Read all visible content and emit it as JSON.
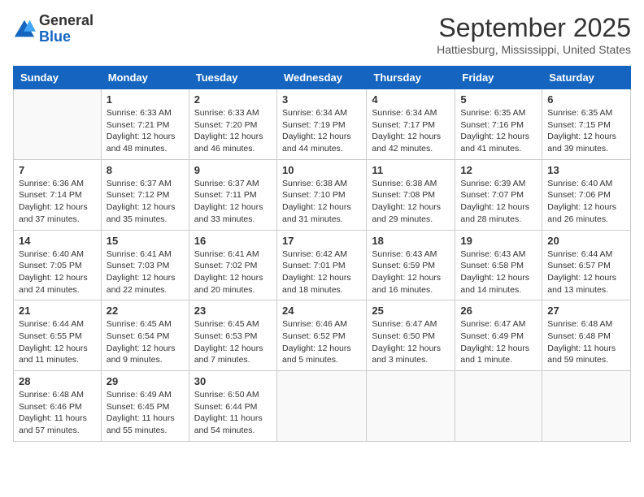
{
  "header": {
    "logo_general": "General",
    "logo_blue": "Blue",
    "month": "September 2025",
    "location": "Hattiesburg, Mississippi, United States"
  },
  "days_of_week": [
    "Sunday",
    "Monday",
    "Tuesday",
    "Wednesday",
    "Thursday",
    "Friday",
    "Saturday"
  ],
  "weeks": [
    [
      {
        "day": "",
        "empty": true
      },
      {
        "day": "1",
        "sunrise": "6:33 AM",
        "sunset": "7:21 PM",
        "daylight": "12 hours and 48 minutes."
      },
      {
        "day": "2",
        "sunrise": "6:33 AM",
        "sunset": "7:20 PM",
        "daylight": "12 hours and 46 minutes."
      },
      {
        "day": "3",
        "sunrise": "6:34 AM",
        "sunset": "7:19 PM",
        "daylight": "12 hours and 44 minutes."
      },
      {
        "day": "4",
        "sunrise": "6:34 AM",
        "sunset": "7:17 PM",
        "daylight": "12 hours and 42 minutes."
      },
      {
        "day": "5",
        "sunrise": "6:35 AM",
        "sunset": "7:16 PM",
        "daylight": "12 hours and 41 minutes."
      },
      {
        "day": "6",
        "sunrise": "6:35 AM",
        "sunset": "7:15 PM",
        "daylight": "12 hours and 39 minutes."
      }
    ],
    [
      {
        "day": "7",
        "sunrise": "6:36 AM",
        "sunset": "7:14 PM",
        "daylight": "12 hours and 37 minutes."
      },
      {
        "day": "8",
        "sunrise": "6:37 AM",
        "sunset": "7:12 PM",
        "daylight": "12 hours and 35 minutes."
      },
      {
        "day": "9",
        "sunrise": "6:37 AM",
        "sunset": "7:11 PM",
        "daylight": "12 hours and 33 minutes."
      },
      {
        "day": "10",
        "sunrise": "6:38 AM",
        "sunset": "7:10 PM",
        "daylight": "12 hours and 31 minutes."
      },
      {
        "day": "11",
        "sunrise": "6:38 AM",
        "sunset": "7:08 PM",
        "daylight": "12 hours and 29 minutes."
      },
      {
        "day": "12",
        "sunrise": "6:39 AM",
        "sunset": "7:07 PM",
        "daylight": "12 hours and 28 minutes."
      },
      {
        "day": "13",
        "sunrise": "6:40 AM",
        "sunset": "7:06 PM",
        "daylight": "12 hours and 26 minutes."
      }
    ],
    [
      {
        "day": "14",
        "sunrise": "6:40 AM",
        "sunset": "7:05 PM",
        "daylight": "12 hours and 24 minutes."
      },
      {
        "day": "15",
        "sunrise": "6:41 AM",
        "sunset": "7:03 PM",
        "daylight": "12 hours and 22 minutes."
      },
      {
        "day": "16",
        "sunrise": "6:41 AM",
        "sunset": "7:02 PM",
        "daylight": "12 hours and 20 minutes."
      },
      {
        "day": "17",
        "sunrise": "6:42 AM",
        "sunset": "7:01 PM",
        "daylight": "12 hours and 18 minutes."
      },
      {
        "day": "18",
        "sunrise": "6:43 AM",
        "sunset": "6:59 PM",
        "daylight": "12 hours and 16 minutes."
      },
      {
        "day": "19",
        "sunrise": "6:43 AM",
        "sunset": "6:58 PM",
        "daylight": "12 hours and 14 minutes."
      },
      {
        "day": "20",
        "sunrise": "6:44 AM",
        "sunset": "6:57 PM",
        "daylight": "12 hours and 13 minutes."
      }
    ],
    [
      {
        "day": "21",
        "sunrise": "6:44 AM",
        "sunset": "6:55 PM",
        "daylight": "12 hours and 11 minutes."
      },
      {
        "day": "22",
        "sunrise": "6:45 AM",
        "sunset": "6:54 PM",
        "daylight": "12 hours and 9 minutes."
      },
      {
        "day": "23",
        "sunrise": "6:45 AM",
        "sunset": "6:53 PM",
        "daylight": "12 hours and 7 minutes."
      },
      {
        "day": "24",
        "sunrise": "6:46 AM",
        "sunset": "6:52 PM",
        "daylight": "12 hours and 5 minutes."
      },
      {
        "day": "25",
        "sunrise": "6:47 AM",
        "sunset": "6:50 PM",
        "daylight": "12 hours and 3 minutes."
      },
      {
        "day": "26",
        "sunrise": "6:47 AM",
        "sunset": "6:49 PM",
        "daylight": "12 hours and 1 minute."
      },
      {
        "day": "27",
        "sunrise": "6:48 AM",
        "sunset": "6:48 PM",
        "daylight": "11 hours and 59 minutes."
      }
    ],
    [
      {
        "day": "28",
        "sunrise": "6:48 AM",
        "sunset": "6:46 PM",
        "daylight": "11 hours and 57 minutes."
      },
      {
        "day": "29",
        "sunrise": "6:49 AM",
        "sunset": "6:45 PM",
        "daylight": "11 hours and 55 minutes."
      },
      {
        "day": "30",
        "sunrise": "6:50 AM",
        "sunset": "6:44 PM",
        "daylight": "11 hours and 54 minutes."
      },
      {
        "day": "",
        "empty": true
      },
      {
        "day": "",
        "empty": true
      },
      {
        "day": "",
        "empty": true
      },
      {
        "day": "",
        "empty": true
      }
    ]
  ]
}
